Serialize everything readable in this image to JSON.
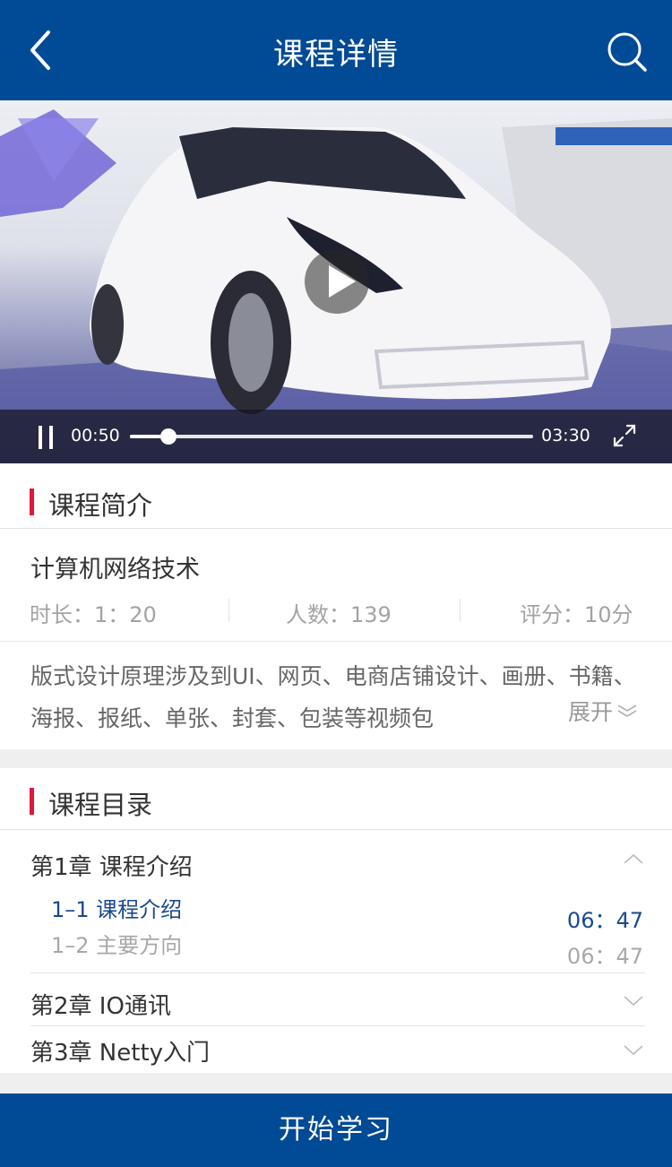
{
  "header": {
    "title": "课程详情",
    "back_icon": "back-arrow-icon",
    "search_icon": "search-icon"
  },
  "player": {
    "current_time": "00:50",
    "total_time": "03:30",
    "progress": 0.095
  },
  "intro": {
    "heading": "课程简介",
    "course_name": "计算机网络技术",
    "duration": "时长：1：20",
    "people": "人数：139",
    "rating": "评分：10分",
    "description": "版式设计原理涉及到UI、网页、电商店铺设计、画册、书籍、海报、报纸、单张、封套、包装等视频包",
    "expand_label": "展开"
  },
  "catalog": {
    "heading": "课程目录",
    "chapters": [
      {
        "title": "第1章 课程介绍",
        "expanded": true,
        "lessons": [
          {
            "title": "1–1 课程介绍",
            "duration": "06：47",
            "active": true
          },
          {
            "title": "1–2 主要方向",
            "duration": "06：47",
            "active": false
          }
        ]
      },
      {
        "title": "第2章 IO通讯",
        "expanded": false
      },
      {
        "title": "第3章 Netty入门",
        "expanded": false
      }
    ]
  },
  "footer": {
    "start_label": "开始学习"
  },
  "colors": {
    "primary": "#004a96",
    "accent": "#e0163c",
    "active_text": "#1a4a8c"
  }
}
